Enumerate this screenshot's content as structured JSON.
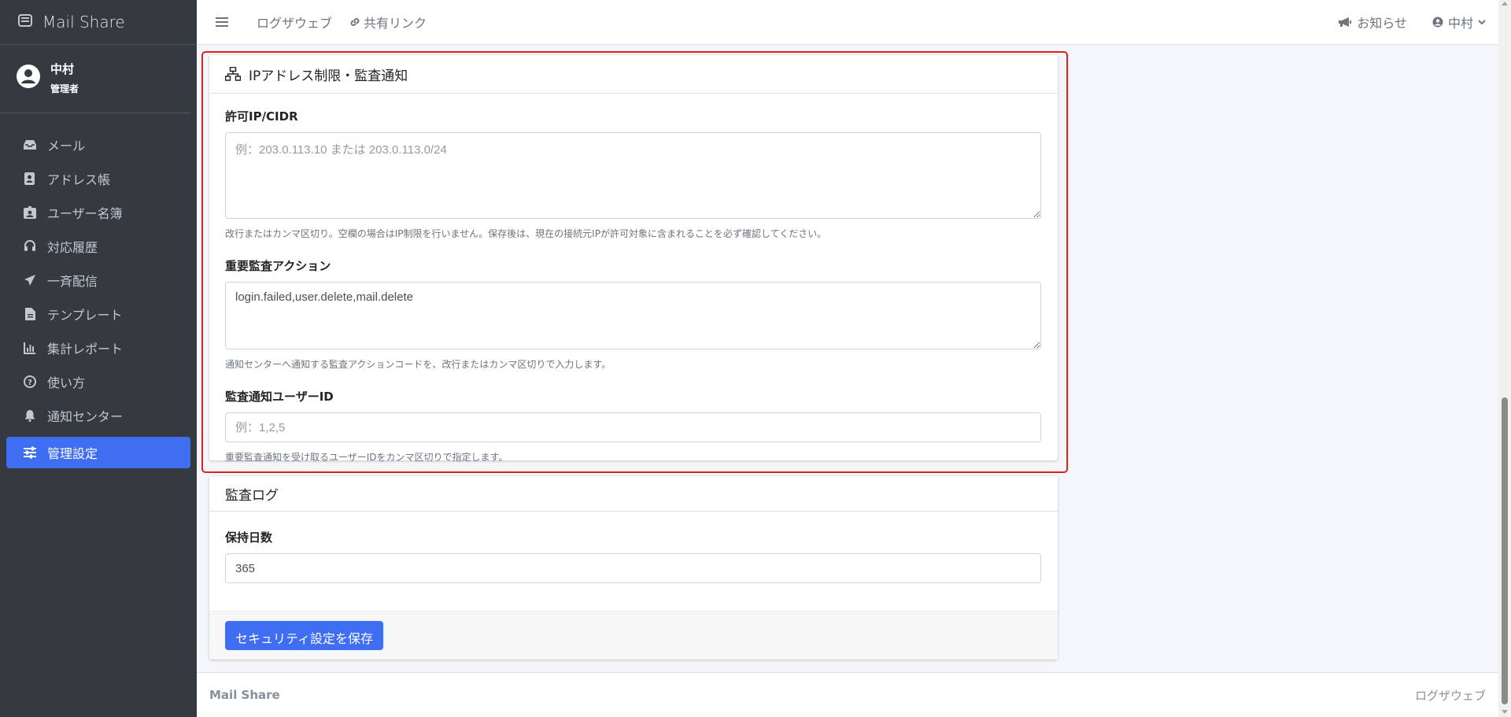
{
  "app": {
    "brand": "Mail Share",
    "icon": "envelope-box-icon"
  },
  "user": {
    "name": "中村",
    "role": "管理者"
  },
  "sidebar": {
    "items": [
      {
        "label": "メール",
        "icon": "inbox-icon"
      },
      {
        "label": "アドレス帳",
        "icon": "address-book-icon"
      },
      {
        "label": "ユーザー名簿",
        "icon": "id-badge-icon"
      },
      {
        "label": "対応履歴",
        "icon": "headset-icon"
      },
      {
        "label": "一斉配信",
        "icon": "paper-plane-icon"
      },
      {
        "label": "テンプレート",
        "icon": "file-icon"
      },
      {
        "label": "集計レポート",
        "icon": "chart-bar-icon"
      },
      {
        "label": "使い方",
        "icon": "question-circle-icon"
      },
      {
        "label": "通知センター",
        "icon": "bell-icon"
      },
      {
        "label": "管理設定",
        "icon": "sliders-icon",
        "active": true
      }
    ]
  },
  "topbar": {
    "logout_web": "ログザウェブ",
    "share_link": "共有リンク",
    "notices": "お知らせ",
    "user_menu": "中村"
  },
  "ip_section": {
    "title": "IPアドレス制限・監査通知",
    "allowed_ip_label": "許可IP/CIDR",
    "allowed_ip_placeholder": "例：203.0.113.10 または 203.0.113.0/24",
    "allowed_ip_help": "改行またはカンマ区切り。空欄の場合はIP制限を行いません。保存後は、現在の接続元IPが許可対象に含まれることを必ず確認してください。",
    "critical_actions_label": "重要監査アクション",
    "critical_actions_value": "login.failed,user.delete,mail.delete",
    "critical_actions_help": "通知センターへ通知する監査アクションコードを、改行またはカンマ区切りで入力します。",
    "notify_user_ids_label": "監査通知ユーザーID",
    "notify_user_ids_placeholder": "例：1,2,5",
    "notify_user_ids_help": "重要監査通知を受け取るユーザーIDをカンマ区切りで指定します。"
  },
  "audit_log": {
    "title": "監査ログ",
    "retention_label": "保持日数",
    "retention_value": "365",
    "save_button": "セキュリティ設定を保存"
  },
  "footer": {
    "left": "Mail Share",
    "right": "ログザウェブ"
  },
  "colors": {
    "sidebar_bg": "#343a40",
    "accent": "#3f6ef2",
    "highlight": "#e02020"
  }
}
